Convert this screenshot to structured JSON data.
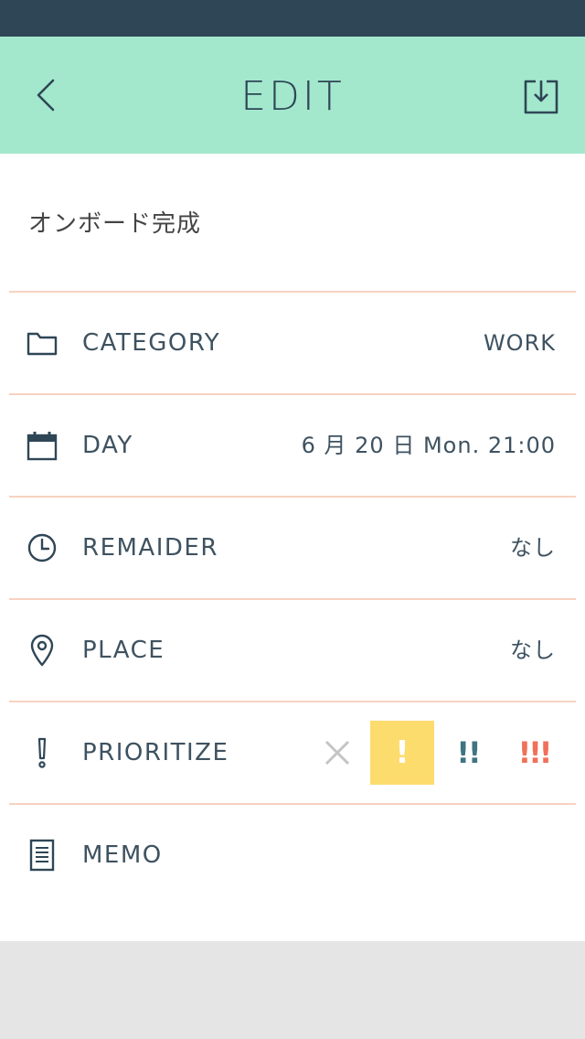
{
  "header": {
    "title": "EDIT",
    "back_icon": "chevron-left-icon",
    "save_icon": "save-download-icon"
  },
  "task": {
    "title": "オンボード完成"
  },
  "rows": {
    "category": {
      "icon": "folder-icon",
      "label": "CATEGORY",
      "value": "WORK"
    },
    "day": {
      "icon": "calendar-icon",
      "label": "DAY",
      "value": "6 月 20 日 Mon. 21:00"
    },
    "reminder": {
      "icon": "clock-icon",
      "label": "REMAIDER",
      "value": "なし"
    },
    "place": {
      "icon": "location-pin-icon",
      "label": "PLACE",
      "value": "なし"
    },
    "prioritize": {
      "icon": "exclamation-icon",
      "label": "PRIORITIZE"
    },
    "memo": {
      "icon": "document-icon",
      "label": "MEMO"
    }
  },
  "priority": {
    "options": [
      "none",
      "low",
      "medium",
      "high"
    ],
    "selected": "low",
    "low_glyph": "!",
    "medium_glyph": "!!",
    "high_glyph": "!!!"
  },
  "colors": {
    "status_bar": "#2f4656",
    "header": "#a3e8cd",
    "divider": "#f8d2c0",
    "priority_selected_bg": "#fddc6e",
    "priority_medium": "#3f7480",
    "priority_high": "#f0705a",
    "footer": "#e5e5e5"
  }
}
